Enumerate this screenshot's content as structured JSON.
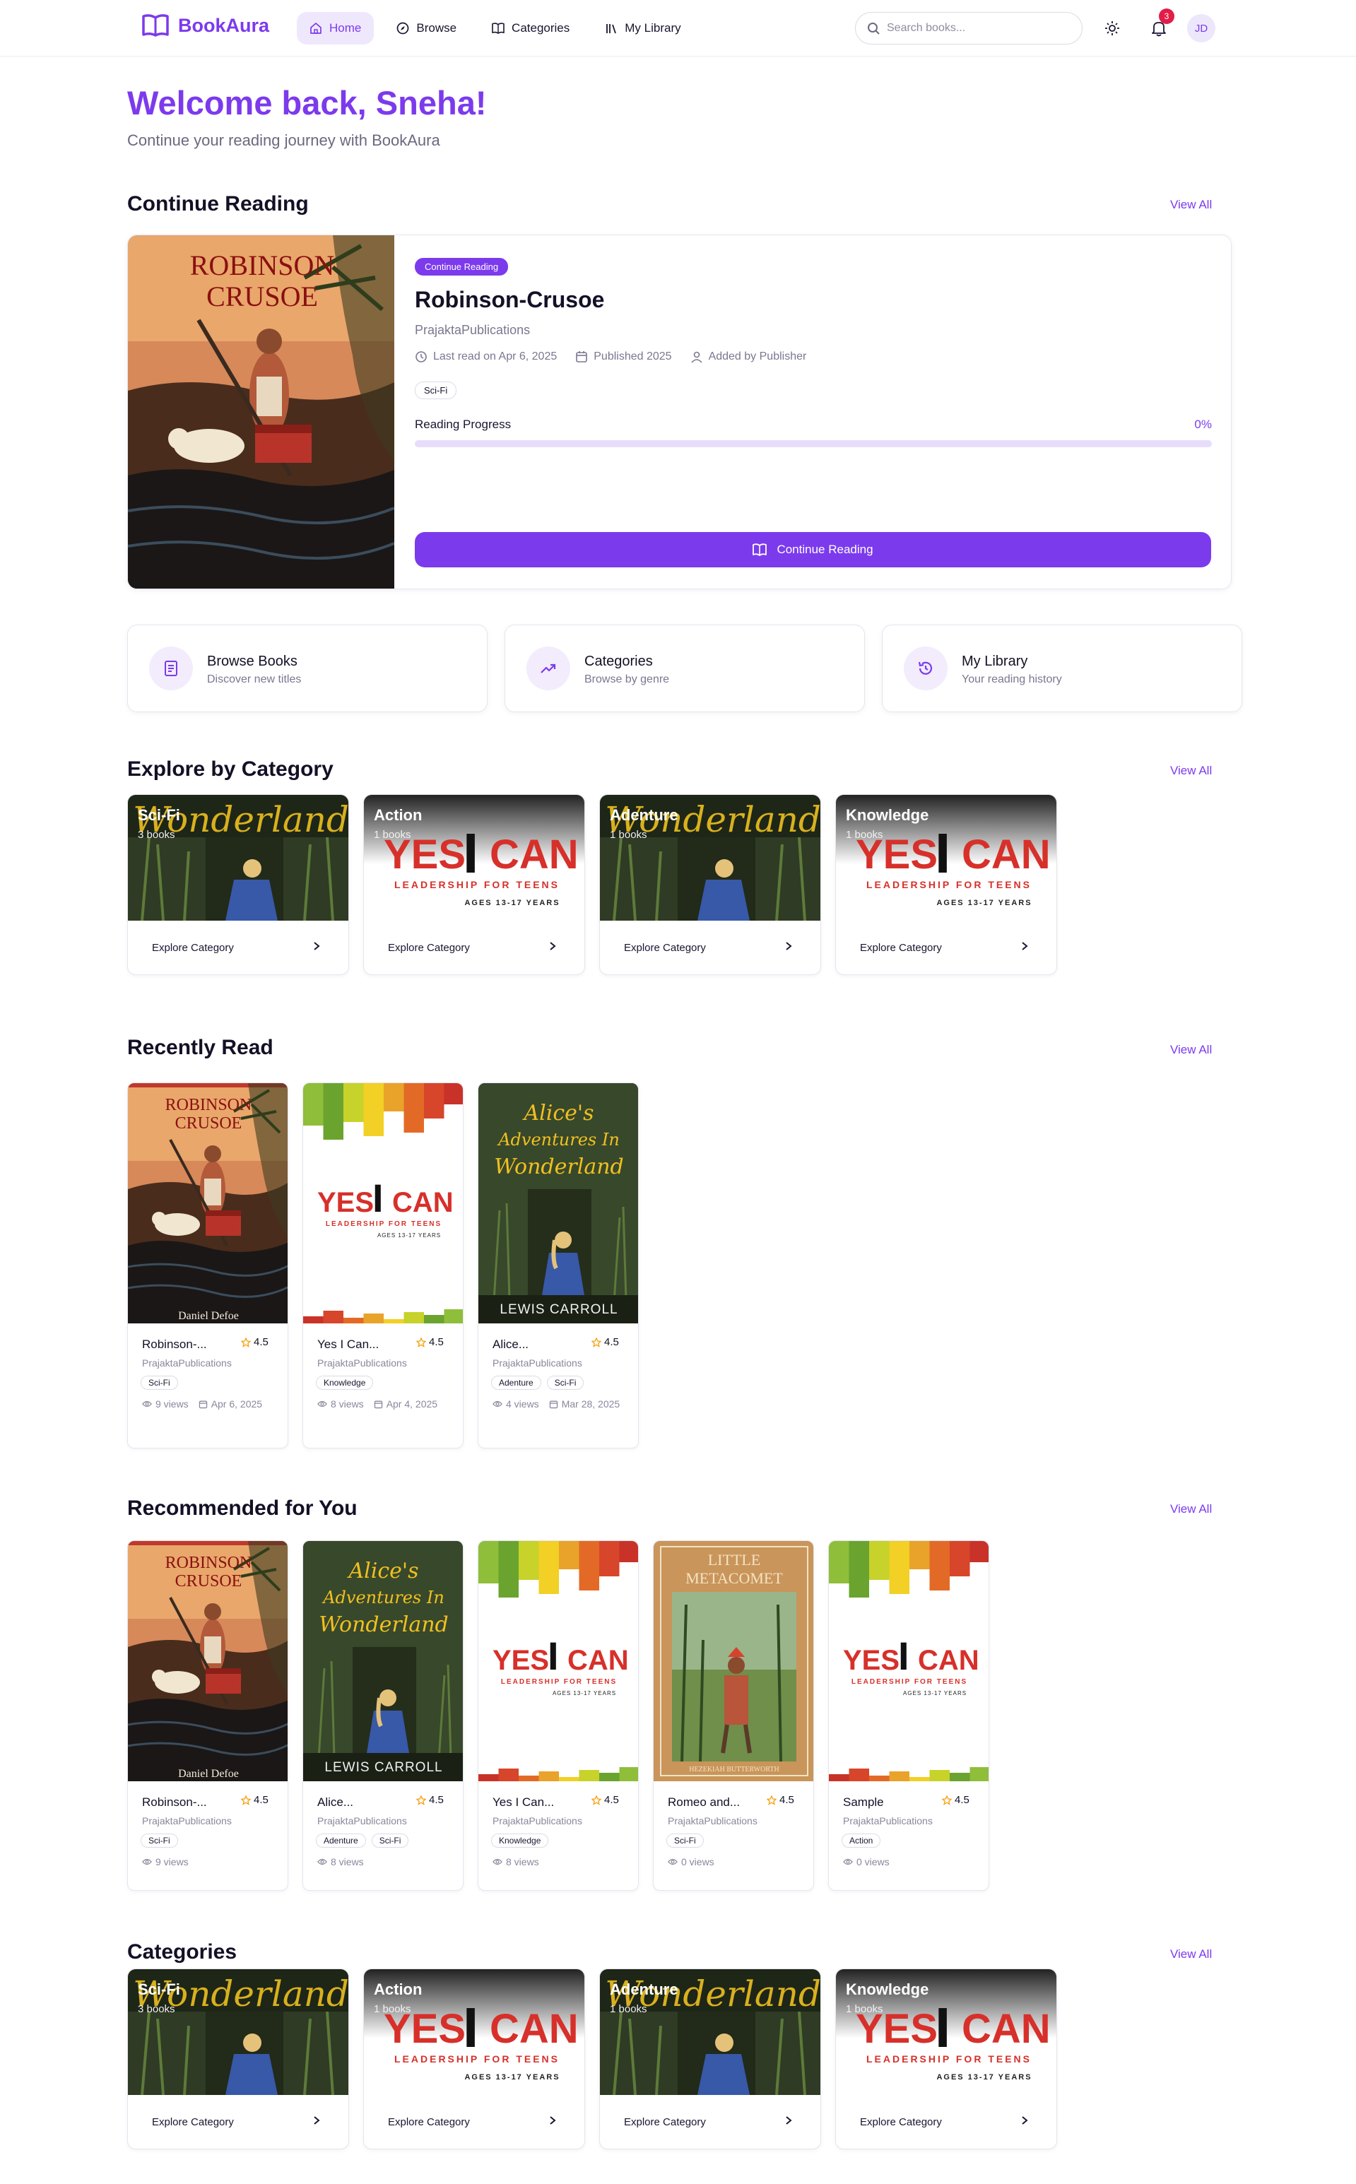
{
  "nav": {
    "brand": "BookAura",
    "links": [
      {
        "label": "Home",
        "icon": "home-icon",
        "active": true
      },
      {
        "label": "Browse",
        "icon": "compass-icon",
        "active": false
      },
      {
        "label": "Categories",
        "icon": "book-open-icon",
        "active": false
      },
      {
        "label": "My Library",
        "icon": "library-icon",
        "active": false
      }
    ],
    "search_placeholder": "Search books...",
    "notification_count": "3",
    "avatar_initials": "JD"
  },
  "welcome": {
    "title": "Welcome back, Sneha!",
    "subtitle": "Continue your reading journey with BookAura"
  },
  "continue_reading": {
    "section_title": "Continue Reading",
    "view_all": "View All",
    "pill": "Continue Reading",
    "book_title": "Robinson-Crusoe",
    "publisher": "PrajaktaPublications",
    "last_read": "Last read on Apr 6, 2025",
    "published": "Published 2025",
    "added_by": "Added by Publisher",
    "tag": "Sci-Fi",
    "progress_label": "Reading Progress",
    "progress_value": "0%",
    "progress_fraction": 0,
    "button_label": "Continue Reading"
  },
  "quick_actions": [
    {
      "title": "Browse Books",
      "subtitle": "Discover new titles",
      "icon": "document-icon"
    },
    {
      "title": "Categories",
      "subtitle": "Browse by genre",
      "icon": "trending-icon"
    },
    {
      "title": "My Library",
      "subtitle": "Your reading history",
      "icon": "history-icon"
    }
  ],
  "explore": {
    "section_title": "Explore by Category",
    "view_all": "View All",
    "cards": [
      {
        "name": "Sci-Fi",
        "count": "3 books",
        "cover": "wonderland",
        "cta": "Explore Category"
      },
      {
        "name": "Action",
        "count": "1 books",
        "cover": "yesican",
        "cta": "Explore Category"
      },
      {
        "name": "Adenture",
        "count": "1 books",
        "cover": "wonderland",
        "cta": "Explore Category"
      },
      {
        "name": "Knowledge",
        "count": "1 books",
        "cover": "yesican",
        "cta": "Explore Category"
      }
    ]
  },
  "recently_read": {
    "section_title": "Recently Read",
    "view_all": "View All",
    "books": [
      {
        "title": "Robinson-...",
        "rating": "4.5",
        "publisher": "PrajaktaPublications",
        "tags": [
          "Sci-Fi"
        ],
        "views": "9 views",
        "date": "Apr 6, 2025",
        "cover": "robinson"
      },
      {
        "title": "Yes I Can...",
        "rating": "4.5",
        "publisher": "PrajaktaPublications",
        "tags": [
          "Knowledge"
        ],
        "views": "8 views",
        "date": "Apr 4, 2025",
        "cover": "yesican"
      },
      {
        "title": "Alice...",
        "rating": "4.5",
        "publisher": "PrajaktaPublications",
        "tags": [
          "Adenture",
          "Sci-Fi"
        ],
        "views": "4 views",
        "date": "Mar 28, 2025",
        "cover": "alice"
      }
    ]
  },
  "recommended": {
    "section_title": "Recommended for You",
    "view_all": "View All",
    "books": [
      {
        "title": "Robinson-...",
        "rating": "4.5",
        "publisher": "PrajaktaPublications",
        "tags": [
          "Sci-Fi"
        ],
        "views": "9 views",
        "cover": "robinson"
      },
      {
        "title": "Alice...",
        "rating": "4.5",
        "publisher": "PrajaktaPublications",
        "tags": [
          "Adenture",
          "Sci-Fi"
        ],
        "views": "8 views",
        "cover": "alice"
      },
      {
        "title": "Yes I Can...",
        "rating": "4.5",
        "publisher": "PrajaktaPublications",
        "tags": [
          "Knowledge"
        ],
        "views": "8 views",
        "cover": "yesican"
      },
      {
        "title": "Romeo and...",
        "rating": "4.5",
        "publisher": "PrajaktaPublications",
        "tags": [
          "Sci-Fi"
        ],
        "views": "0 views",
        "cover": "metacomet"
      },
      {
        "title": "Sample",
        "rating": "4.5",
        "publisher": "PrajaktaPublications",
        "tags": [
          "Action"
        ],
        "views": "0 views",
        "cover": "yesican"
      }
    ]
  },
  "categories": {
    "section_title": "Categories",
    "view_all": "View All",
    "cards": [
      {
        "name": "Sci-Fi",
        "count": "3 books",
        "cover": "wonderland",
        "cta": "Explore Category"
      },
      {
        "name": "Action",
        "count": "1 books",
        "cover": "yesican",
        "cta": "Explore Category"
      },
      {
        "name": "Adenture",
        "count": "1 books",
        "cover": "wonderland",
        "cta": "Explore Category"
      },
      {
        "name": "Knowledge",
        "count": "1 books",
        "cover": "yesican",
        "cta": "Explore Category"
      }
    ]
  },
  "cover_text": {
    "robinson_title": [
      "ROBINSON",
      "CRUSOE"
    ],
    "robinson_author": "Daniel Defoe",
    "alice_title": [
      "Alice's",
      "Adventures In",
      "Wonderland"
    ],
    "alice_author": "LEWIS CARROLL",
    "wonderland_word": "Wonderland",
    "yesican_word1": "YES",
    "yesican_word2": "I",
    "yesican_word3": "CAN",
    "yesican_sub": "LEADERSHIP FOR TEENS",
    "yesican_ages": "AGES 13-17 YEARS",
    "metacomet_title": [
      "LITTLE",
      "METACOMET"
    ],
    "metacomet_author": "HEZEKIAH BUTTERWORTH"
  },
  "colors": {
    "accent": "#7c3aed",
    "accent_light": "#efe8fd",
    "badge": "#e11d48",
    "star": "#f59e0b"
  }
}
